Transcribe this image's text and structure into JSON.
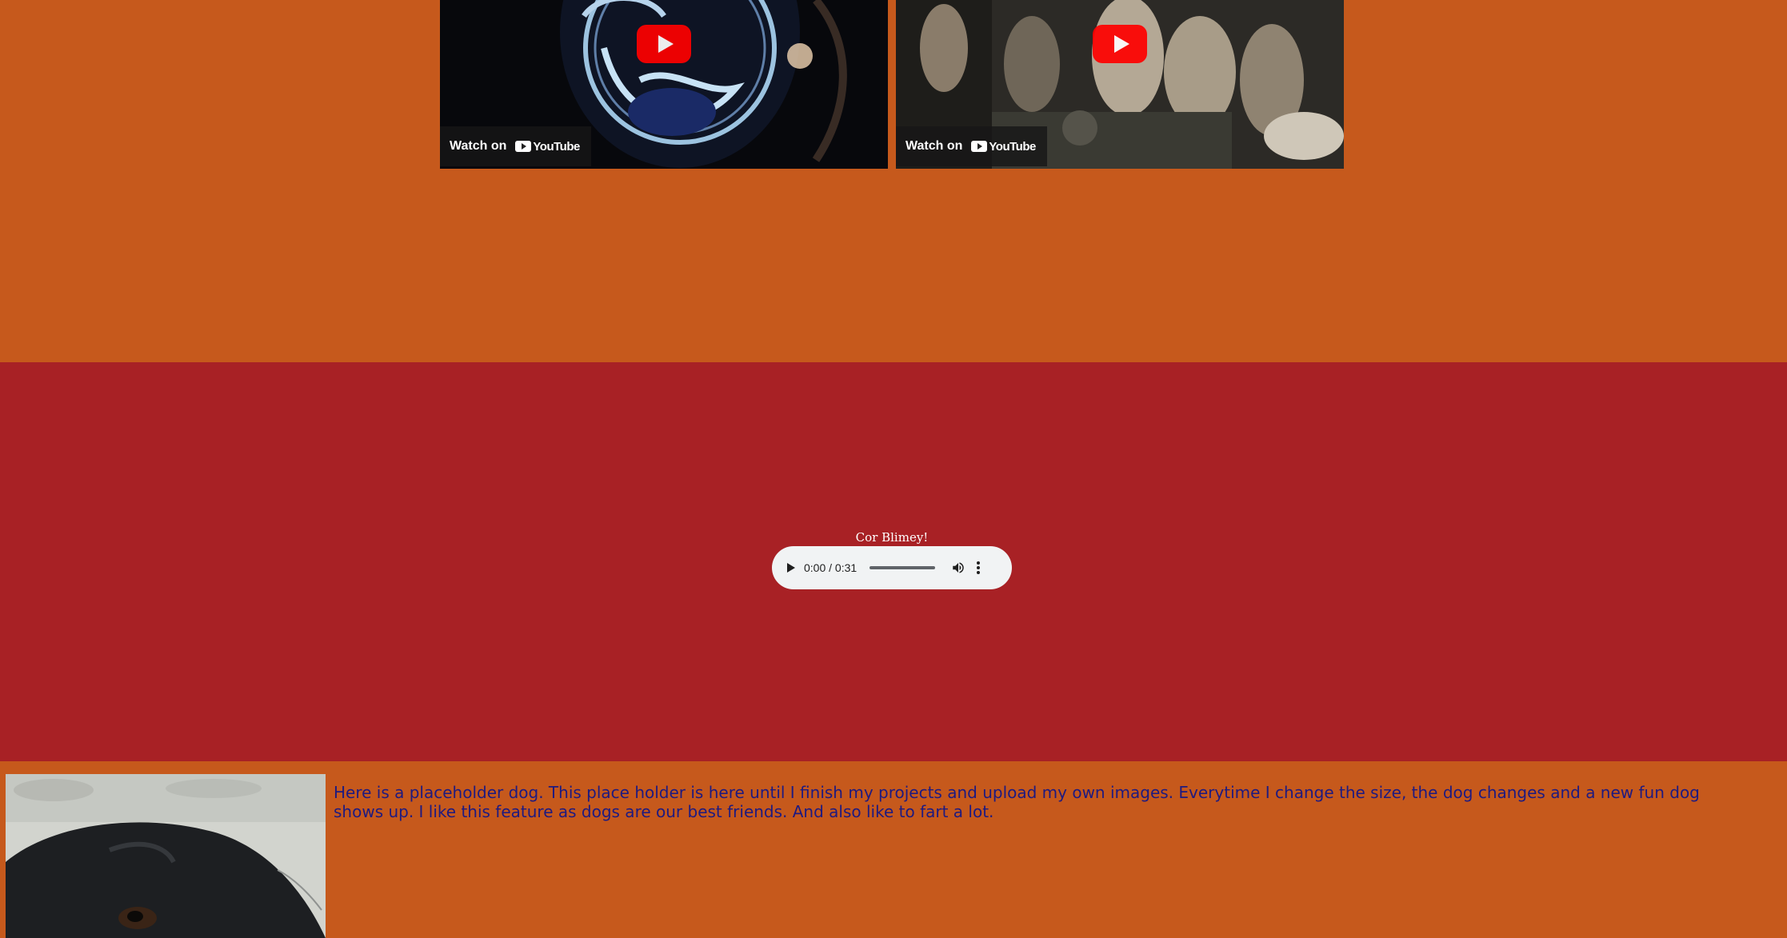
{
  "videos": [
    {
      "watch_label": "Watch on",
      "platform": "YouTube"
    },
    {
      "watch_label": "Watch on",
      "platform": "YouTube"
    }
  ],
  "audio": {
    "title": "Cor Blimey!",
    "time": "0:00 / 0:31",
    "progress": 0
  },
  "dog_section": {
    "text": "Here is a placeholder dog. This place holder is here until I finish my projects and upload my own images. Everytime I change the size, the dog changes and a new fun dog shows up. I like this feature as dogs are our best friends. And also like to fart a lot."
  },
  "colors": {
    "page_background": "#c6591c",
    "band_red": "#a82125",
    "text_navy": "#1e1a80",
    "youtube_red": "#ff0000"
  }
}
